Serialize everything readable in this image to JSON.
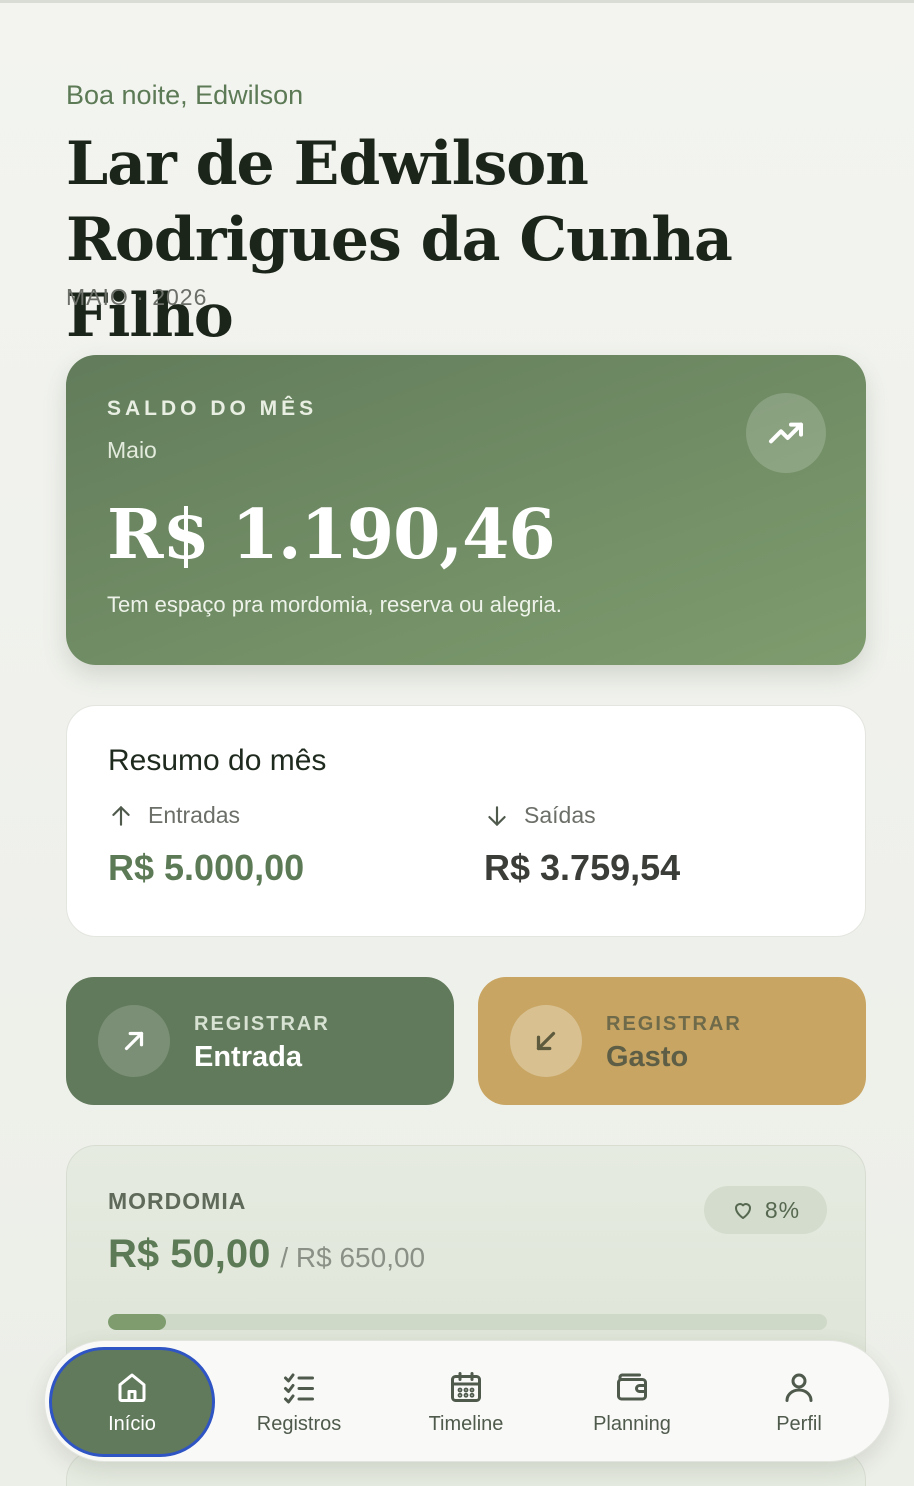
{
  "header": {
    "greeting": "Boa noite, Edwilson",
    "title": "Lar de Edwilson Rodrigues da Cunha Filho",
    "period": "MAIO · 2026"
  },
  "balance": {
    "eyebrow": "SALDO DO MÊS",
    "month": "Maio",
    "amount": "R$ 1.190,46",
    "note": "Tem espaço pra mordomia, reserva ou alegria.",
    "icon": "trending-up-icon"
  },
  "summary": {
    "title": "Resumo do mês",
    "income_label": "Entradas",
    "income_value": "R$ 5.000,00",
    "expense_label": "Saídas",
    "expense_value": "R$ 3.759,54"
  },
  "actions": {
    "income": {
      "eyebrow": "REGISTRAR",
      "label": "Entrada",
      "icon": "arrow-up-right-icon"
    },
    "expense": {
      "eyebrow": "REGISTRAR",
      "label": "Gasto",
      "icon": "arrow-down-left-icon"
    }
  },
  "budget": {
    "name": "MORDOMIA",
    "spent": "R$ 50,00",
    "limit": "/ R$ 650,00",
    "percent_label": "8%",
    "progress": 0.08
  },
  "nav": {
    "items": [
      {
        "label": "Início",
        "icon": "home-icon",
        "active": true
      },
      {
        "label": "Registros",
        "icon": "checklist-icon",
        "active": false
      },
      {
        "label": "Timeline",
        "icon": "calendar-icon",
        "active": false
      },
      {
        "label": "Planning",
        "icon": "wallet-icon",
        "active": false
      },
      {
        "label": "Perfil",
        "icon": "user-icon",
        "active": false
      }
    ]
  },
  "colors": {
    "primary": "#627a5c",
    "accent_gold": "#c8a562",
    "focus_ring": "#2f55c4"
  }
}
